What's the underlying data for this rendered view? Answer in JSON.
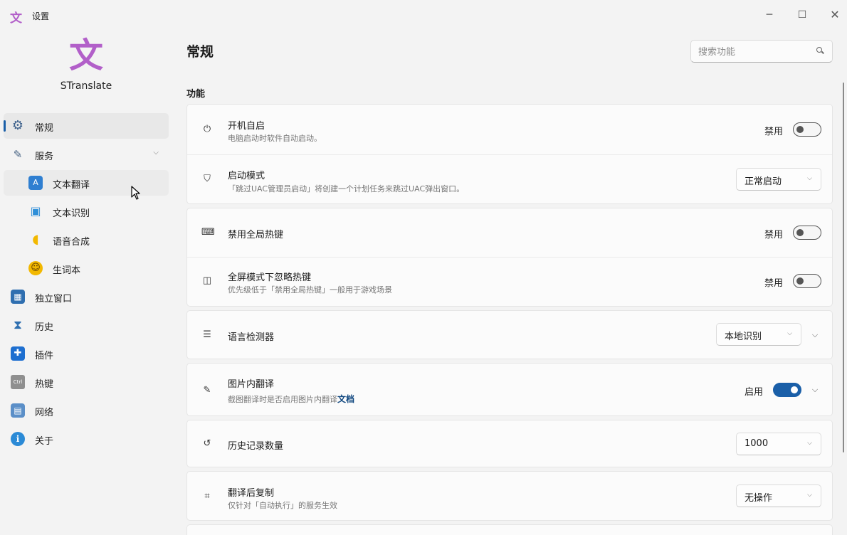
{
  "app": {
    "icon": "translate-logo-icon",
    "title": "设置",
    "brand": "STranslate",
    "accent": "#1a5fa8",
    "brand_color": "#b25fc9"
  },
  "window_controls": {
    "minimize": "─",
    "maximize": "☐",
    "close": "✕"
  },
  "sidebar": {
    "items": [
      {
        "label": "常规",
        "icon": "gear-icon",
        "glyph": "⚙",
        "active": true
      },
      {
        "label": "服务",
        "icon": "wrench-icon",
        "glyph": "🔧",
        "expanded": true
      },
      {
        "label": "文本翻译",
        "icon": "translate-icon",
        "glyph": "A",
        "child": true,
        "hovered": true
      },
      {
        "label": "文本识别",
        "icon": "ocr-icon",
        "glyph": "▣",
        "child": true
      },
      {
        "label": "语音合成",
        "icon": "speech-icon",
        "glyph": "◖",
        "child": true
      },
      {
        "label": "生词本",
        "icon": "vocabulary-icon",
        "glyph": "☺",
        "child": true
      },
      {
        "label": "独立窗口",
        "icon": "window-icon",
        "glyph": "▦"
      },
      {
        "label": "历史",
        "icon": "hourglass-icon",
        "glyph": "⧗"
      },
      {
        "label": "插件",
        "icon": "plugin-icon",
        "glyph": "✚"
      },
      {
        "label": "热键",
        "icon": "keyboard-icon",
        "glyph": "Ctrl"
      },
      {
        "label": "网络",
        "icon": "network-icon",
        "glyph": "▤"
      },
      {
        "label": "关于",
        "icon": "info-icon",
        "glyph": "i"
      }
    ]
  },
  "main": {
    "title": "常规",
    "search": {
      "placeholder": "搜索功能",
      "value": ""
    },
    "section_title": "功能",
    "rows": {
      "autostart": {
        "icon": "power-icon",
        "glyph": "⏻",
        "title": "开机自启",
        "desc": "电脑启动时软件自动启动。",
        "state_label": "禁用",
        "on": false
      },
      "startup_mode": {
        "icon": "shield-icon",
        "glyph": "⛉",
        "title": "启动模式",
        "desc": "「跳过UAC管理员启动」将创建一个计划任务来跳过UAC弹出窗口。",
        "value": "正常启动"
      },
      "disable_hotkeys": {
        "icon": "keyboard-icon",
        "glyph": "⌨",
        "title": "禁用全局热键",
        "state_label": "禁用",
        "on": false
      },
      "fullscreen_ignore": {
        "icon": "gamepad-icon",
        "glyph": "◫",
        "title": "全屏模式下忽略热键",
        "desc": "优先级低于「禁用全局热键」一般用于游戏场景",
        "state_label": "禁用",
        "on": false
      },
      "language_detector": {
        "icon": "language-detect-icon",
        "glyph": "☰",
        "title": "语言检测器",
        "value": "本地识别"
      },
      "image_translate": {
        "icon": "image-edit-icon",
        "glyph": "✎",
        "title": "图片内翻译",
        "desc": "截图翻译时是否启用图片内翻译",
        "link": "文档",
        "state_label": "启用",
        "on": true
      },
      "history_count": {
        "icon": "history-icon",
        "glyph": "↺",
        "title": "历史记录数量",
        "value": "1000"
      },
      "copy_after_translate": {
        "icon": "crop-icon",
        "glyph": "⌗",
        "title": "翻译后复制",
        "desc": "仅针对「自动执行」的服务生效",
        "value": "无操作"
      }
    }
  }
}
